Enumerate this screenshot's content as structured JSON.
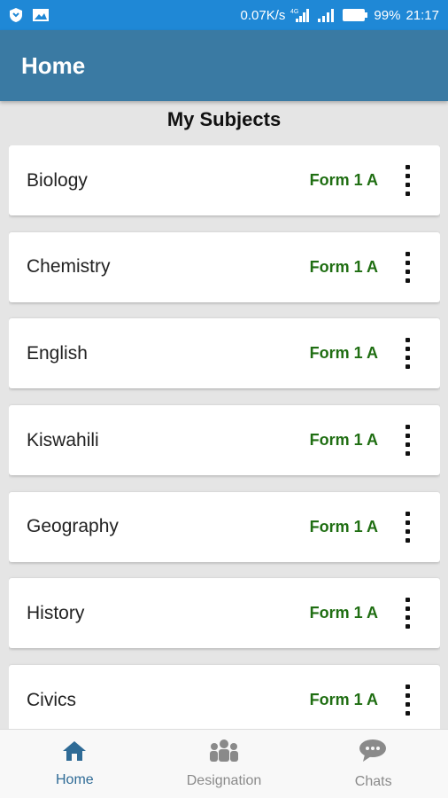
{
  "status_bar": {
    "network_speed": "0.07K/s",
    "network_type": "4G",
    "battery": "99%",
    "time": "21:17",
    "icons": [
      "shield-icon",
      "image-icon",
      "signal-4g-icon",
      "signal-icon",
      "battery-icon"
    ]
  },
  "app_bar": {
    "title": "Home"
  },
  "section": {
    "title": "My Subjects"
  },
  "subjects": [
    {
      "name": "Biology",
      "form": "Form 1 A"
    },
    {
      "name": "Chemistry",
      "form": "Form 1 A"
    },
    {
      "name": "English",
      "form": "Form 1 A"
    },
    {
      "name": "Kiswahili",
      "form": "Form 1 A"
    },
    {
      "name": "Geography",
      "form": "Form 1 A"
    },
    {
      "name": "History",
      "form": "Form 1 A"
    },
    {
      "name": "Civics",
      "form": "Form 1 A"
    }
  ],
  "bottom_nav": {
    "items": [
      {
        "label": "Home",
        "icon": "home-icon",
        "active": true
      },
      {
        "label": "Designation",
        "icon": "group-icon",
        "active": false
      },
      {
        "label": "Chats",
        "icon": "chat-icon",
        "active": false
      }
    ]
  },
  "colors": {
    "status_bar": "#1f88d6",
    "app_bar": "#3a7aa3",
    "form_label": "#1f6e12",
    "nav_active": "#2f6b96",
    "nav_inactive": "#8a8a8a"
  }
}
